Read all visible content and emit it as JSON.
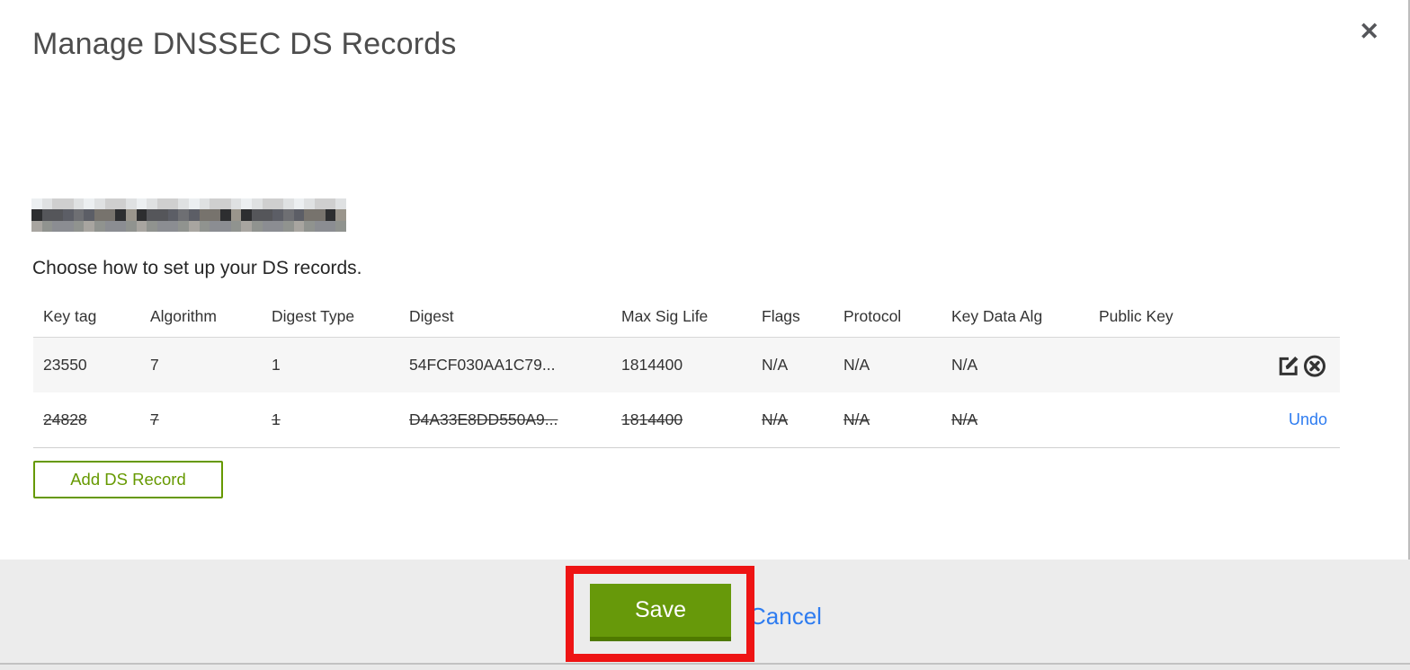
{
  "modal": {
    "title": "Manage DNSSEC DS Records",
    "close_glyph": "✕",
    "domain_redacted": true,
    "intro": "Choose how to set up your DS records."
  },
  "table": {
    "columns": {
      "key_tag": "Key tag",
      "algorithm": "Algorithm",
      "digest_type": "Digest Type",
      "digest": "Digest",
      "max_sig_life": "Max Sig Life",
      "flags": "Flags",
      "protocol": "Protocol",
      "key_data_alg": "Key Data Alg",
      "public_key": "Public Key"
    },
    "rows": [
      {
        "key_tag": "23550",
        "algorithm": "7",
        "digest_type": "1",
        "digest": "54FCF030AA1C79...",
        "max_sig_life": "1814400",
        "flags": "N/A",
        "protocol": "N/A",
        "key_data_alg": "N/A",
        "public_key": "",
        "state": "normal",
        "actions": [
          "edit-icon",
          "circle-x-icon"
        ]
      },
      {
        "key_tag": "24828",
        "algorithm": "7",
        "digest_type": "1",
        "digest": "D4A33E8DD550A9...",
        "max_sig_life": "1814400",
        "flags": "N/A",
        "protocol": "N/A",
        "key_data_alg": "N/A",
        "public_key": "",
        "state": "deleted",
        "action_label": "Undo"
      }
    ]
  },
  "buttons": {
    "add_ds_record": "Add DS Record",
    "save": "Save",
    "cancel": "Cancel"
  },
  "colors": {
    "green": "#669900",
    "green_dark": "#4f7a00",
    "link_blue": "#2e7cf0",
    "annotation_red": "#ee1414",
    "footer_bg": "#ececec",
    "row_keep_bg": "#f6f6f6",
    "text": "#333333"
  }
}
